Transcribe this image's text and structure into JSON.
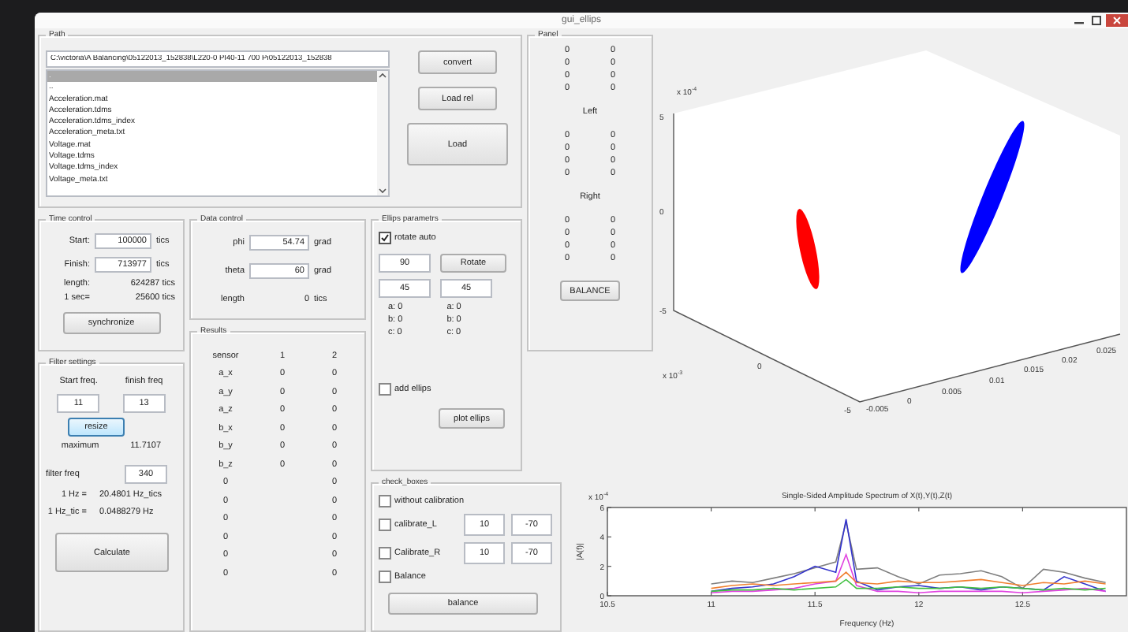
{
  "window": {
    "title": "gui_ellips"
  },
  "path_panel": {
    "title": "Path",
    "path": "C:\\victoria\\A Balancing\\05122013_152838\\L220-0 PI40-11 700 Pi05122013_152838",
    "files": [
      {
        "name": ".",
        "selected": true
      },
      {
        "name": "..",
        "selected": false
      },
      {
        "name": "Acceleration.mat",
        "selected": false
      },
      {
        "name": "Acceleration.tdms",
        "selected": false
      },
      {
        "name": "Acceleration.tdms_index",
        "selected": false
      },
      {
        "name": "Acceleration_meta.txt",
        "selected": false
      },
      {
        "name": "Voltage.mat",
        "selected": false
      },
      {
        "name": "Voltage.tdms",
        "selected": false
      },
      {
        "name": "Voltage.tdms_index",
        "selected": false
      },
      {
        "name": "Voltage_meta.txt",
        "selected": false
      }
    ],
    "buttons": [
      "convert",
      "Load rel",
      "Load"
    ]
  },
  "panel": {
    "title": "Panel",
    "blocks": [
      {
        "kind": "values",
        "values": [
          "0",
          "0"
        ]
      },
      {
        "kind": "values",
        "values": [
          "0",
          "0"
        ]
      },
      {
        "kind": "values",
        "values": [
          "0",
          "0"
        ]
      },
      {
        "kind": "values",
        "values": [
          "0",
          "0"
        ]
      },
      {
        "kind": "heading",
        "text": "Left"
      },
      {
        "kind": "values",
        "values": [
          "0",
          "0"
        ]
      },
      {
        "kind": "values",
        "values": [
          "0",
          "0"
        ]
      },
      {
        "kind": "values",
        "values": [
          "0",
          "0"
        ]
      },
      {
        "kind": "values",
        "values": [
          "0",
          "0"
        ]
      },
      {
        "kind": "heading",
        "text": "Right"
      },
      {
        "kind": "values",
        "values": [
          "0",
          "0"
        ]
      },
      {
        "kind": "values",
        "values": [
          "0",
          "0"
        ]
      },
      {
        "kind": "values",
        "values": [
          "0",
          "0"
        ]
      },
      {
        "kind": "values",
        "values": [
          "0",
          "0"
        ]
      }
    ],
    "button": "BALANCE"
  },
  "time_control": {
    "title": "Time control",
    "inputs": [
      {
        "label": "Start:",
        "value": "100000",
        "unit": "tics"
      },
      {
        "label": "Finish:",
        "value": "713977",
        "unit": "tics"
      }
    ],
    "readouts": [
      {
        "label": "length:",
        "value": "624287 tics"
      },
      {
        "label": "1 sec=",
        "value": "25600 tics"
      }
    ],
    "button": "synchronize"
  },
  "filter_settings": {
    "title": "Filter settings",
    "start_label": "Start freq.",
    "finish_label": "finish freq",
    "start": "11",
    "finish": "13",
    "resize_button": {
      "label": "resize",
      "focused": true
    },
    "maximum_label": "maximum",
    "maximum": "11.7107",
    "filter_label": "filter freq",
    "filter": "340",
    "conversions": [
      {
        "label": "1 Hz =",
        "value": "20.4801 Hz_tics"
      },
      {
        "label": "1 Hz_tic =",
        "value": "0.0488279 Hz"
      }
    ],
    "calculate_button": "Calculate"
  },
  "data_control": {
    "title": "Data control",
    "inputs": [
      {
        "label": "phi",
        "value": "54.74",
        "unit": "grad"
      },
      {
        "label": "theta",
        "value": "60",
        "unit": "grad"
      }
    ],
    "readout": {
      "label": "length",
      "value": "0",
      "unit": "tics"
    }
  },
  "results": {
    "title": "Results",
    "rows": [
      {
        "kind": "header",
        "cells": [
          "sensor",
          "1",
          "2"
        ]
      },
      {
        "kind": "labeled",
        "cells": [
          "a_x",
          "0",
          "0"
        ]
      },
      {
        "kind": "labeled",
        "cells": [
          "a_y",
          "0",
          "0"
        ]
      },
      {
        "kind": "labeled",
        "cells": [
          "a_z",
          "0",
          "0"
        ]
      },
      {
        "kind": "labeled",
        "cells": [
          "b_x",
          "0",
          "0"
        ]
      },
      {
        "kind": "labeled",
        "cells": [
          "b_y",
          "0",
          "0"
        ]
      },
      {
        "kind": "labeled",
        "cells": [
          "b_z",
          "0",
          "0"
        ]
      },
      {
        "kind": "plain",
        "cells": [
          "0",
          "0"
        ]
      },
      {
        "kind": "plain",
        "cells": [
          "0",
          "0"
        ]
      },
      {
        "kind": "plain",
        "cells": [
          "0",
          "0"
        ]
      },
      {
        "kind": "plain",
        "cells": [
          "0",
          "0"
        ]
      },
      {
        "kind": "plain",
        "cells": [
          "0",
          "0"
        ]
      },
      {
        "kind": "plain",
        "cells": [
          "0",
          "0"
        ]
      }
    ]
  },
  "ellips_parameters": {
    "title": "Ellips parametrs",
    "rotate_auto": {
      "label": "rotate auto",
      "checked": true
    },
    "angle": "90",
    "rotate_button": "Rotate",
    "angles": [
      "45",
      "45"
    ],
    "params": [
      [
        "a: 0",
        "b: 0",
        "c: 0"
      ],
      [
        "a: 0",
        "b: 0",
        "c: 0"
      ]
    ],
    "add_ellips": {
      "label": "add ellips",
      "checked": false
    },
    "plot_button": "plot ellips"
  },
  "check_boxes": {
    "title": "check_boxes",
    "items": [
      {
        "label": "without calibration",
        "checked": false
      },
      {
        "label": "calibrate_L",
        "checked": false,
        "values": [
          "10",
          "-70"
        ]
      },
      {
        "label": "Calibrate_R",
        "checked": false,
        "values": [
          "10",
          "-70"
        ]
      },
      {
        "label": "Balance",
        "checked": false
      }
    ],
    "button": "balance"
  },
  "plot3d": {
    "z_exponent": {
      "base": "x 10",
      "power": "-4"
    },
    "z_ticks": [
      "5",
      "0",
      "-5"
    ],
    "y_exponent": {
      "base": "x 10",
      "power": "-3"
    },
    "y_ticks": [
      "0",
      "-5"
    ],
    "x_ticks": [
      "-0.005",
      "0",
      "0.005",
      "0.01",
      "0.015",
      "0.02",
      "0.025"
    ]
  },
  "spectrum": {
    "y_exponent": {
      "base": "x 10",
      "power": "-4"
    },
    "chart_data": {
      "type": "line",
      "title": "Single-Sided Amplitude Spectrum of X(t),Y(t),Z(t)",
      "xlabel": "Frequency (Hz)",
      "ylabel": "|A(f)|",
      "x": [
        11,
        11.1,
        11.2,
        11.3,
        11.4,
        11.5,
        11.6,
        11.65,
        11.7,
        11.8,
        11.9,
        12,
        12.1,
        12.2,
        12.3,
        12.4,
        12.5,
        12.6,
        12.7,
        12.8,
        12.9
      ],
      "series": [
        {
          "color": "#7f7f7f",
          "values": [
            0.8,
            1.0,
            0.9,
            1.2,
            1.5,
            1.9,
            2.3,
            5.0,
            1.8,
            1.9,
            1.3,
            0.8,
            1.4,
            1.5,
            1.7,
            1.3,
            0.5,
            1.8,
            1.6,
            1.2,
            0.9
          ]
        },
        {
          "color": "#3333cc",
          "values": [
            0.3,
            0.5,
            0.6,
            0.8,
            1.3,
            2.0,
            1.6,
            5.2,
            1.0,
            0.4,
            0.6,
            0.7,
            0.5,
            0.6,
            0.4,
            0.6,
            0.5,
            0.4,
            1.3,
            0.8,
            0.3
          ]
        },
        {
          "color": "#e040e0",
          "values": [
            0.2,
            0.3,
            0.3,
            0.4,
            0.5,
            0.8,
            1.0,
            2.8,
            0.7,
            0.3,
            0.3,
            0.2,
            0.3,
            0.3,
            0.3,
            0.3,
            0.2,
            0.3,
            0.4,
            0.5,
            0.3
          ]
        },
        {
          "color": "#f08030",
          "values": [
            0.5,
            0.7,
            0.8,
            0.7,
            0.8,
            0.9,
            1.0,
            1.6,
            0.9,
            0.8,
            1.0,
            0.9,
            0.9,
            1.0,
            1.1,
            0.9,
            0.7,
            0.9,
            0.8,
            1.0,
            0.8
          ]
        },
        {
          "color": "#40c040",
          "values": [
            0.3,
            0.4,
            0.4,
            0.5,
            0.4,
            0.5,
            0.6,
            1.1,
            0.5,
            0.5,
            0.6,
            0.5,
            0.5,
            0.6,
            0.5,
            0.6,
            0.5,
            0.4,
            0.5,
            0.4,
            0.5
          ]
        }
      ],
      "xlim": [
        10.5,
        13
      ],
      "ylim": [
        0,
        6
      ],
      "xticks": [
        10.5,
        11,
        11.5,
        12,
        12.5
      ],
      "yticks": [
        0,
        2,
        4,
        6
      ]
    }
  }
}
